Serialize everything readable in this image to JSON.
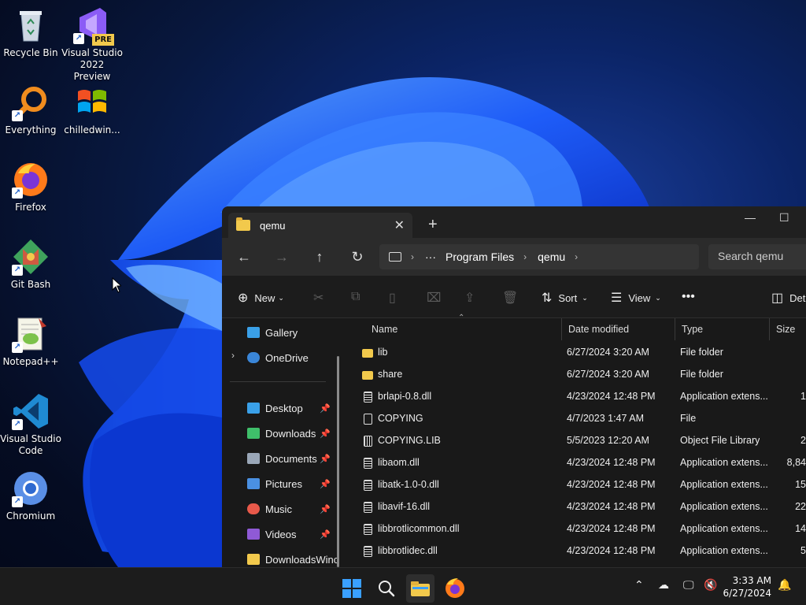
{
  "desktop": {
    "icons": [
      {
        "label": "Recycle Bin",
        "icon": "recycle-bin-icon"
      },
      {
        "label": "Visual Studio 2022 Preview",
        "icon": "visual-studio-icon",
        "badge": "PRE"
      },
      {
        "label": "Everything",
        "icon": "everything-search-icon"
      },
      {
        "label": "chilledwin...",
        "icon": "windows-logo-icon"
      },
      {
        "label": "Firefox",
        "icon": "firefox-icon"
      },
      {
        "label": "Git Bash",
        "icon": "git-icon"
      },
      {
        "label": "Notepad++",
        "icon": "notepad-plus-plus-icon"
      },
      {
        "label": "Visual Studio Code",
        "icon": "vscode-icon"
      },
      {
        "label": "Chromium",
        "icon": "chromium-icon"
      }
    ]
  },
  "explorer": {
    "tab_title": "qemu",
    "breadcrumb": [
      "Program Files",
      "qemu"
    ],
    "breadcrumb_ellipsis": "···",
    "search_placeholder": "Search qemu",
    "commands": {
      "new": "New",
      "sort": "Sort",
      "view": "View",
      "details": "Details"
    },
    "nav": {
      "gallery": "Gallery",
      "onedrive": "OneDrive",
      "quick_access": [
        {
          "label": "Desktop",
          "color": "#3aa0e8"
        },
        {
          "label": "Downloads",
          "color": "#3fbf6a"
        },
        {
          "label": "Documents",
          "color": "#9aa7b8"
        },
        {
          "label": "Pictures",
          "color": "#4a90e2"
        },
        {
          "label": "Music",
          "color": "#e8594a"
        },
        {
          "label": "Videos",
          "color": "#8f5ad6"
        },
        {
          "label": "DownloadsWinc",
          "color": "#f2c94c"
        }
      ]
    },
    "columns": [
      "Name",
      "Date modified",
      "Type",
      "Size"
    ],
    "files": [
      {
        "name": "lib",
        "date": "6/27/2024 3:20 AM",
        "type": "File folder",
        "size": "",
        "kind": "folder"
      },
      {
        "name": "share",
        "date": "6/27/2024 3:20 AM",
        "type": "File folder",
        "size": "",
        "kind": "folder"
      },
      {
        "name": "brlapi-0.8.dll",
        "date": "4/23/2024 12:48 PM",
        "type": "Application extens...",
        "size": "1",
        "kind": "dll"
      },
      {
        "name": "COPYING",
        "date": "4/7/2023 1:47 AM",
        "type": "File",
        "size": "",
        "kind": "file"
      },
      {
        "name": "COPYING.LIB",
        "date": "5/5/2023 12:20 AM",
        "type": "Object File Library",
        "size": "2",
        "kind": "lib"
      },
      {
        "name": "libaom.dll",
        "date": "4/23/2024 12:48 PM",
        "type": "Application extens...",
        "size": "8,84",
        "kind": "dll"
      },
      {
        "name": "libatk-1.0-0.dll",
        "date": "4/23/2024 12:48 PM",
        "type": "Application extens...",
        "size": "15",
        "kind": "dll"
      },
      {
        "name": "libavif-16.dll",
        "date": "4/23/2024 12:48 PM",
        "type": "Application extens...",
        "size": "22",
        "kind": "dll"
      },
      {
        "name": "libbrotlicommon.dll",
        "date": "4/23/2024 12:48 PM",
        "type": "Application extens...",
        "size": "14",
        "kind": "dll"
      },
      {
        "name": "libbrotlidec.dll",
        "date": "4/23/2024 12:48 PM",
        "type": "Application extens...",
        "size": "5",
        "kind": "dll"
      }
    ]
  },
  "taskbar": {
    "clock_time": "3:33 AM",
    "clock_date": "6/27/2024"
  }
}
